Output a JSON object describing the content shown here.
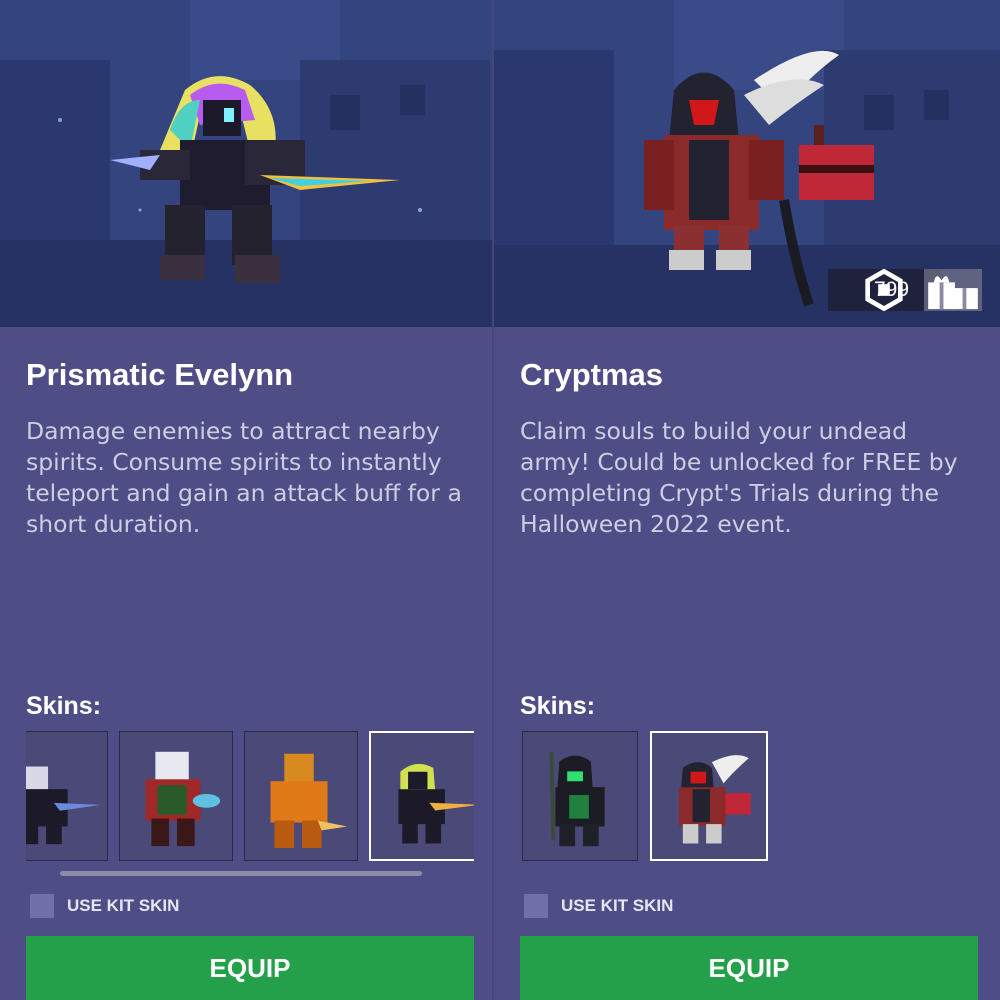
{
  "kits": [
    {
      "name": "Prismatic Evelynn",
      "description": "Damage enemies to attract nearby spirits. Consume spirits to instantly teleport and gain an attack buff for a short duration.",
      "skins_label": "Skins:",
      "skins": [
        {
          "icon": "evelynn-dark-skin-thumbnail"
        },
        {
          "icon": "evelynn-festive-skin-thumbnail"
        },
        {
          "icon": "evelynn-gold-skin-thumbnail"
        },
        {
          "icon": "prismatic-evelynn-skin-thumbnail",
          "selected": true
        }
      ],
      "use_kit_skin_label": "USE KIT SKIN",
      "equip_label": "EQUIP"
    },
    {
      "name": "Cryptmas",
      "description": "Claim souls to build your undead army! Could be unlocked for FREE by completing Crypt's Trials during the Halloween 2022 event.",
      "price": "799",
      "skins_label": "Skins:",
      "skins": [
        {
          "icon": "crypt-green-skin-thumbnail"
        },
        {
          "icon": "cryptmas-skin-thumbnail",
          "selected": true
        }
      ],
      "use_kit_skin_label": "USE KIT SKIN",
      "equip_label": "EQUIP"
    }
  ],
  "colors": {
    "panel": "#4f4d85",
    "equip": "#25a04a",
    "checkbox": "#7270aa"
  }
}
